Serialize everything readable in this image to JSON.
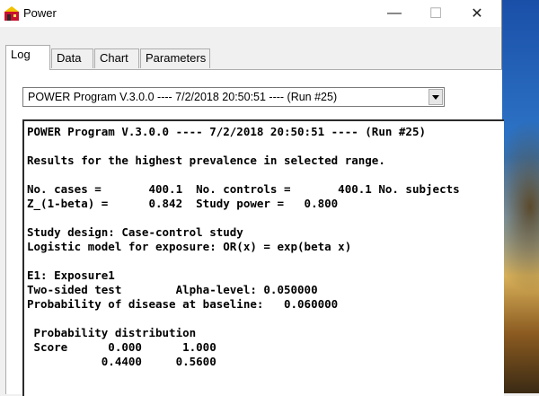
{
  "window": {
    "title": "Power",
    "icon": "power-app-icon",
    "controls": {
      "minimize": "—",
      "maximize": "☐",
      "close": "✕"
    }
  },
  "tabs": [
    {
      "label": "Log",
      "active": true
    },
    {
      "label": "Data",
      "active": false
    },
    {
      "label": "Chart",
      "active": false
    },
    {
      "label": "Parameters",
      "active": false
    }
  ],
  "run_select": {
    "value": "POWER Program V.3.0.0 ---- 7/2/2018 20:50:51 ---- (Run #25)"
  },
  "log": {
    "lines": [
      "POWER Program V.3.0.0 ---- 7/2/2018 20:50:51 ---- (Run #25)",
      "",
      "Results for the highest prevalence in selected range.",
      "",
      "No. cases =       400.1  No. controls =       400.1 No. subjects",
      "Z_(1-beta) =      0.842  Study power =   0.800",
      "",
      "Study design: Case-control study",
      "Logistic model for exposure: OR(x) = exp(beta x)",
      "",
      "E1: Exposure1",
      "Two-sided test        Alpha-level: 0.050000",
      "Probability of disease at baseline:   0.060000",
      "",
      " Probability distribution",
      " Score      0.000      1.000",
      "           0.4400     0.5600"
    ]
  }
}
